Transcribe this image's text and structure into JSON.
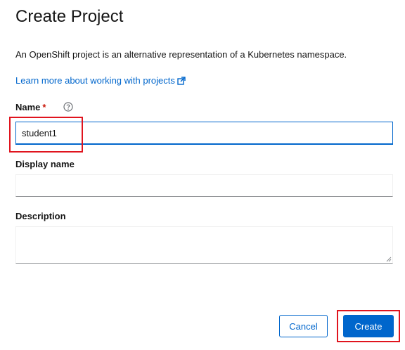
{
  "dialog": {
    "title": "Create Project",
    "description": "An OpenShift project is an alternative representation of a Kubernetes namespace.",
    "learn_more": "Learn more about working with projects"
  },
  "form": {
    "name_label": "Name",
    "required_marker": "*",
    "name_value": "student1",
    "display_name_label": "Display name",
    "display_name_value": "",
    "description_label": "Description",
    "description_value": ""
  },
  "footer": {
    "cancel_label": "Cancel",
    "create_label": "Create"
  },
  "icons": {
    "help": "help-circle-icon",
    "external_link": "external-link-icon",
    "resize": "resize-grip-icon"
  },
  "colors": {
    "accent": "#0066cc",
    "required": "#c9190b",
    "highlight": "#e0141e"
  }
}
